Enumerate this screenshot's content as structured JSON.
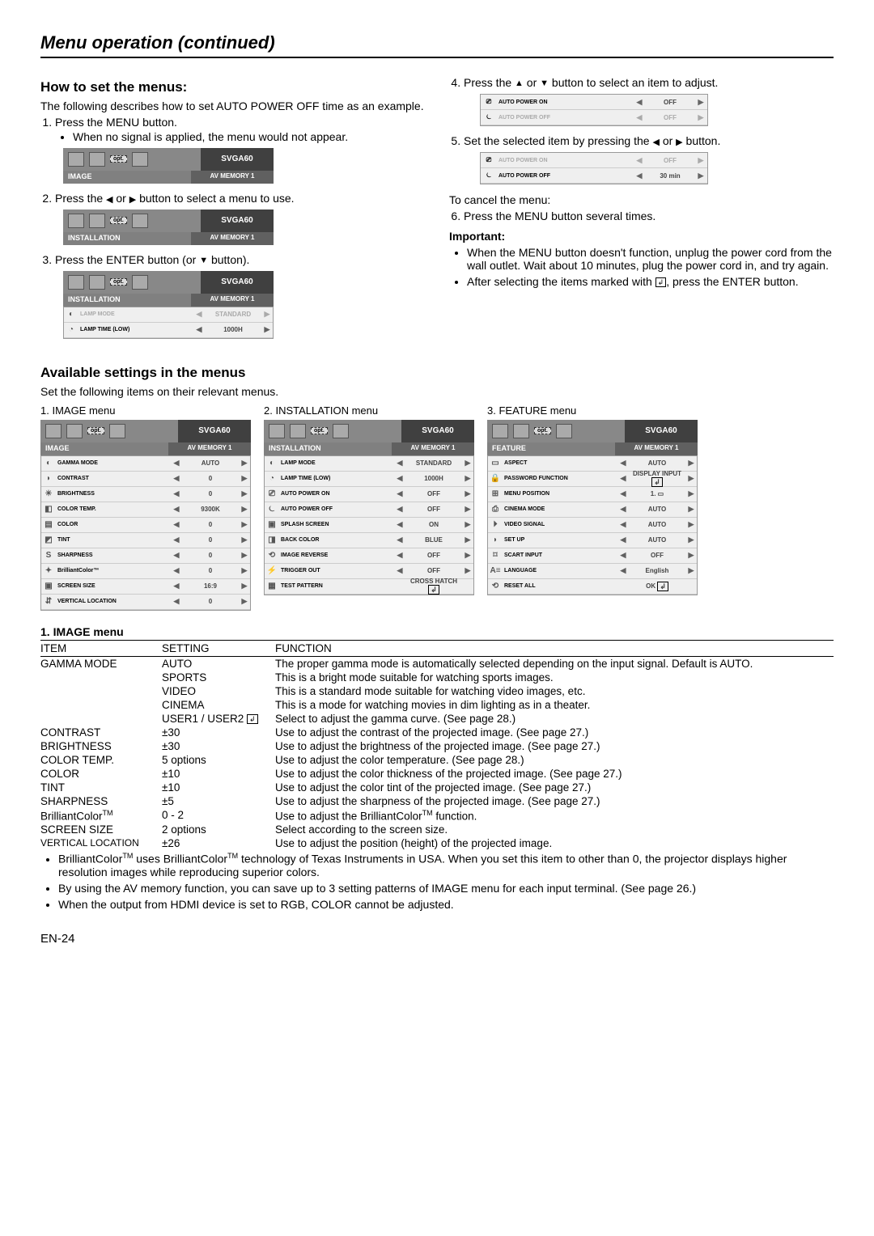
{
  "title": "Menu operation (continued)",
  "how": {
    "heading": "How to set the menus:",
    "intro": "The following describes how to set AUTO POWER OFF time as an example.",
    "s1": "Press the MENU button.",
    "s1b": "When no signal is applied, the menu would not appear.",
    "s2a": "Press the ",
    "s2b": " or ",
    "s2c": " button to select a menu to use.",
    "s3a": "Press the ENTER button (or ",
    "s3b": " button).",
    "s4a": "Press the ",
    "s4b": " or ",
    "s4c": " button to select an item to adjust.",
    "s5a": "Set the selected item by pressing the ",
    "s5b": " or ",
    "s5c": " button.",
    "cancel": "To cancel the menu:",
    "s6": "Press the MENU button several times.",
    "important": "Important:",
    "imp1": "When the MENU button doesn't function, unplug the power cord from the wall outlet. Wait about 10 minutes, plug the power cord in, and try again.",
    "imp2a": "After selecting the items marked with ",
    "imp2b": ", press the ENTER button."
  },
  "osd": {
    "signal": "SVGA60",
    "opt": "opt.",
    "mem": "AV MEMORY 1",
    "image": "IMAGE",
    "installation": "INSTALLATION",
    "feature": "FEATURE",
    "lamp_mode": "LAMP MODE",
    "standard": "STANDARD",
    "lamp_time": "LAMP TIME (LOW)",
    "lamp_time_v": "1000H",
    "auto_on": "AUTO POWER ON",
    "auto_off": "AUTO POWER OFF",
    "off": "OFF",
    "on": "ON",
    "thirty": "30 min",
    "splash": "SPLASH SCREEN",
    "back": "BACK COLOR",
    "blue": "BLUE",
    "imgrev": "IMAGE REVERSE",
    "trigger": "TRIGGER OUT",
    "test": "TEST PATTERN",
    "cross": "CROSS HATCH",
    "gamma": "GAMMA MODE",
    "auto": "AUTO",
    "contrast": "CONTRAST",
    "brightness": "BRIGHTNESS",
    "colortemp": "COLOR TEMP.",
    "ct_v": "9300K",
    "color": "COLOR",
    "tint": "TINT",
    "sharpness": "SHARPNESS",
    "bc": "BrilliantColor™",
    "screen": "SCREEN SIZE",
    "screen_v": "16:9",
    "vloc": "VERTICAL LOCATION",
    "zero": "0",
    "aspect": "ASPECT",
    "pwd": "PASSWORD FUNCTION",
    "pwd_v": "DISPLAY INPUT",
    "menupos": "MENU POSITION",
    "menupos_v": "1.",
    "cinema": "CINEMA MODE",
    "videosig": "VIDEO SIGNAL",
    "setup": "SET UP",
    "scart": "SCART INPUT",
    "lang": "LANGUAGE",
    "eng": "English",
    "reset": "RESET ALL",
    "ok": "OK"
  },
  "avail": {
    "heading": "Available settings in the menus",
    "sub": "Set the following items on their relevant menus.",
    "m1": "1. IMAGE menu",
    "m2": "2. INSTALLATION menu",
    "m3": "3. FEATURE menu"
  },
  "imgmenu": {
    "title": "1. IMAGE menu",
    "hdr_item": "ITEM",
    "hdr_setting": "SETTING",
    "hdr_func": "FUNCTION",
    "rows": {
      "gamma": "GAMMA MODE",
      "auto": "AUTO",
      "auto_f": "The proper gamma mode is automatically selected depending on the input signal. Default is AUTO.",
      "sports": "SPORTS",
      "sports_f": "This is a bright mode suitable for watching sports images.",
      "video": "VIDEO",
      "video_f": "This is a standard mode suitable for watching video images, etc.",
      "cinema": "CINEMA",
      "cinema_f": "This is a mode for watching movies in dim lighting as in a theater.",
      "user": "USER1   / USER2  ",
      "user_f": "Select to adjust the gamma curve. (See page 28.)",
      "contrast": "CONTRAST",
      "c_s": "±30",
      "c_f": "Use to adjust the contrast of the projected image. (See page 27.)",
      "brightness": "BRIGHTNESS",
      "b_s": "±30",
      "b_f": "Use to adjust the brightness of the projected image. (See page 27.)",
      "colortemp": "COLOR TEMP.",
      "ct_s": "5 options",
      "ct_f": "Use to adjust the color temperature. (See page 28.)",
      "color": "COLOR",
      "col_s": "±10",
      "col_f": "Use to adjust the color thickness of the projected image. (See page 27.)",
      "tint": "TINT",
      "t_s": "±10",
      "t_f": "Use to adjust the color tint of the projected image. (See page 27.)",
      "sharp": "SHARPNESS",
      "sh_s": "±5",
      "sh_f": "Use to adjust the sharpness of the projected image. (See page 27.)",
      "bc": "BrilliantColor",
      "bc_s": "0 - 2",
      "bc_f": "Use to adjust the BrilliantColor",
      "bc_f2": " function.",
      "screen": "SCREEN SIZE",
      "sc_s": "2 options",
      "sc_f": "Select according to the screen size.",
      "vloc": "VERTICAL LOCATION",
      "vl_s": "±26",
      "vl_f": "Use to adjust the position (height) of the projected image."
    }
  },
  "notes": {
    "n1a": "BrilliantColor",
    "n1b": " uses BrilliantColor",
    "n1c": " technology of Texas Instruments in USA. When you set this item to other than 0, the projector displays higher resolution images while reproducing superior colors.",
    "n2": "By using the AV memory function, you can save up to 3 setting patterns of IMAGE menu for each input terminal. (See page 26.)",
    "n3": "When the output from HDMI device is set to RGB, COLOR cannot be adjusted."
  },
  "footer": "EN-24"
}
